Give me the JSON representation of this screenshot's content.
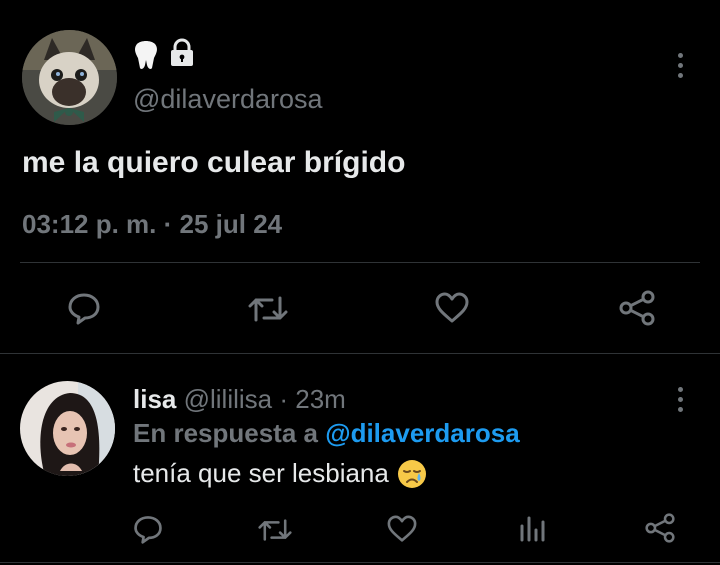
{
  "main_tweet": {
    "handle": "@dilaverdarosa",
    "name_emoji_icons": [
      "tooth-icon",
      "lock-icon"
    ],
    "text": "me la quiero culear brígido",
    "timestamp": "03:12 p. m. · 25 jul 24",
    "actions": [
      "reply-icon",
      "retweet-icon",
      "like-icon",
      "share-icon"
    ]
  },
  "reply": {
    "name": "lisa",
    "handle": "@lililisa",
    "time": "· 23m",
    "in_reply_prefix": "En respuesta a",
    "in_reply_handle": "@dilaverdarosa",
    "text": "tenía que ser lesbiana",
    "emoji": "sad-face-emoji",
    "actions": [
      "reply-icon",
      "retweet-icon",
      "like-icon",
      "views-icon",
      "share-icon"
    ]
  },
  "colors": {
    "background": "#000000",
    "text": "#e7e9ea",
    "secondary": "#71767b",
    "accent": "#1d9bf0",
    "divider": "#2f3336"
  }
}
